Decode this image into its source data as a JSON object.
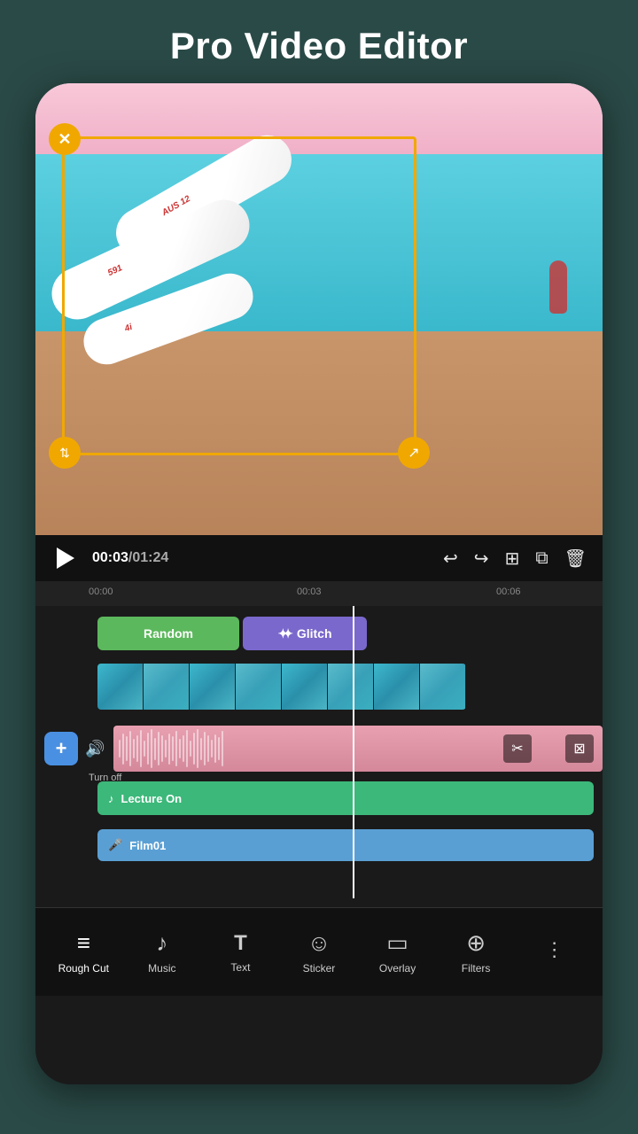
{
  "page": {
    "title": "Pro Video Editor",
    "background_color": "#2a4a47"
  },
  "video_preview": {
    "current_time": "00:03",
    "total_time": "01:24",
    "has_selection": true
  },
  "timeline": {
    "markers": [
      "00:00",
      "00:03",
      "00:06"
    ],
    "tracks": {
      "effects": [
        {
          "label": "Random",
          "type": "green"
        },
        {
          "label": "✦ Glitch",
          "type": "purple"
        }
      ],
      "main_audio": {
        "add_label": "+",
        "turnoff_label": "Turn off"
      },
      "music": {
        "icon": "♪",
        "label": "Lecture On"
      },
      "voice": {
        "icon": "🎤",
        "label": "Film01"
      }
    }
  },
  "toolbar": {
    "undo_label": "↩",
    "redo_label": "↪",
    "split_label": "⊞",
    "copy_label": "⧉",
    "delete_label": "🗑"
  },
  "bottom_nav": {
    "items": [
      {
        "id": "rough-cut",
        "icon": "≡",
        "label": "Rough Cut",
        "active": true
      },
      {
        "id": "music",
        "icon": "♪",
        "label": "Music",
        "active": false
      },
      {
        "id": "text",
        "icon": "T",
        "label": "Text",
        "active": false
      },
      {
        "id": "sticker",
        "icon": "☺",
        "label": "Sticker",
        "active": false
      },
      {
        "id": "overlay",
        "icon": "▭",
        "label": "Overlay",
        "active": false
      },
      {
        "id": "filters",
        "icon": "⊕",
        "label": "Filters",
        "active": false
      },
      {
        "id": "more",
        "icon": "⋮",
        "label": "",
        "active": false
      }
    ]
  }
}
